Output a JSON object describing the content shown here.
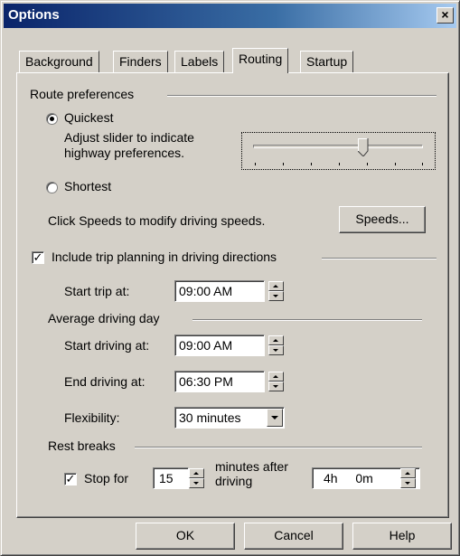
{
  "window": {
    "title": "Options",
    "close_label": "×"
  },
  "tabs": [
    {
      "label": "Background",
      "active": false
    },
    {
      "label": "Finders",
      "active": false
    },
    {
      "label": "Labels",
      "active": false
    },
    {
      "label": "Routing",
      "active": true
    },
    {
      "label": "Startup",
      "active": false
    }
  ],
  "route_prefs": {
    "group_label": "Route preferences",
    "quickest_label": "Quickest",
    "quickest_selected": true,
    "slider_hint_line1": "Adjust slider to indicate",
    "slider_hint_line2": "highway preferences.",
    "slider_value": 0.65,
    "shortest_label": "Shortest",
    "speeds_hint": "Click Speeds to modify driving speeds.",
    "speeds_button": "Speeds..."
  },
  "trip_planning": {
    "checkbox_label": "Include trip planning in driving directions",
    "checked": true,
    "start_trip_label": "Start trip at:",
    "start_trip_value": "09:00 AM"
  },
  "driving_day": {
    "group_label": "Average driving day",
    "start_label": "Start driving at:",
    "start_value": "09:00 AM",
    "end_label": "End driving at:",
    "end_value": "06:30 PM",
    "flex_label": "Flexibility:",
    "flex_value": "30 minutes"
  },
  "rest_breaks": {
    "group_label": "Rest breaks",
    "stop_label": "Stop for",
    "stop_checked": true,
    "stop_minutes": "15",
    "after_line1": "minutes after",
    "after_line2": "driving",
    "interval_hours": "4h",
    "interval_minutes": "0m"
  },
  "footer": {
    "ok": "OK",
    "cancel": "Cancel",
    "help": "Help"
  },
  "check_mark": "✓"
}
